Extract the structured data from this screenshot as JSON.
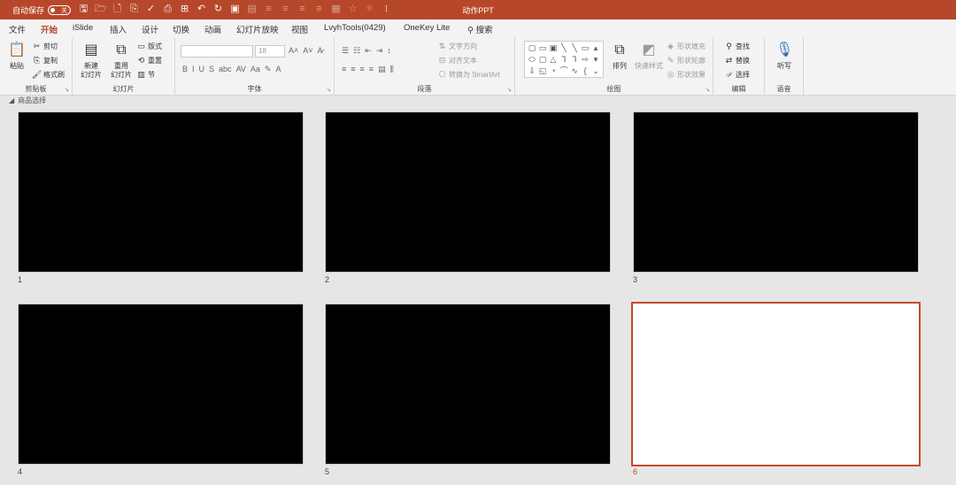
{
  "titlebar": {
    "autosave_label": "自动保存",
    "autosave_state": "关",
    "doc_title": "动作PPT",
    "qat_icons": [
      "save-icon",
      "open-icon",
      "new-icon",
      "format-icon",
      "spell-icon",
      "print-icon",
      "table-icon",
      "undo-icon",
      "redo-icon",
      "start-icon",
      "layout-icon",
      "align-icons",
      "star-icon",
      "more-icon"
    ]
  },
  "menu": {
    "tabs": [
      "文件",
      "开始",
      "iSlide",
      "插入",
      "设计",
      "切换",
      "动画",
      "幻灯片放映",
      "视图",
      "LvyhTools(0429)",
      "OneKey Lite",
      "搜索"
    ],
    "active": "开始"
  },
  "ribbon": {
    "clipboard": {
      "paste": "粘贴",
      "cut": "剪切",
      "copy": "复制",
      "format_painter": "格式刷",
      "label": "剪贴板"
    },
    "slides": {
      "new_slide_1": "新建",
      "new_slide_2": "幻灯片",
      "reuse_1": "重用",
      "reuse_2": "幻灯片",
      "layout": "版式",
      "reset": "重置",
      "section": "节",
      "label": "幻灯片"
    },
    "font": {
      "font_size": "18",
      "bold": "B",
      "italic": "I",
      "underline": "U",
      "shadow": "S",
      "strike": "abc",
      "spacing": "AV",
      "case": "Aa",
      "label": "字体"
    },
    "paragraph": {
      "text_direction": "文字方向",
      "align_text": "对齐文本",
      "smartart": "转换为 SmartArt",
      "label": "段落"
    },
    "drawing": {
      "arrange": "排列",
      "quick_styles": "快速样式",
      "shape_fill": "形状填充",
      "shape_outline": "形状轮廓",
      "shape_effects": "形状效果",
      "label": "绘图"
    },
    "editing": {
      "find": "查找",
      "replace": "替换",
      "select": "选择",
      "label": "编辑"
    },
    "voice": {
      "dictate": "听写",
      "label": "语音"
    }
  },
  "section": {
    "name": "商品选择"
  },
  "slides": [
    {
      "number": "1",
      "fill": "#000000"
    },
    {
      "number": "2",
      "fill": "#000000"
    },
    {
      "number": "3",
      "fill": "#000000"
    },
    {
      "number": "4",
      "fill": "#000000"
    },
    {
      "number": "5",
      "fill": "#000000"
    },
    {
      "number": "6",
      "fill": "#ffffff",
      "selected": true
    }
  ],
  "colors": {
    "accent": "#b7472a",
    "selection": "#c8472a",
    "background": "#e6e6e6"
  }
}
